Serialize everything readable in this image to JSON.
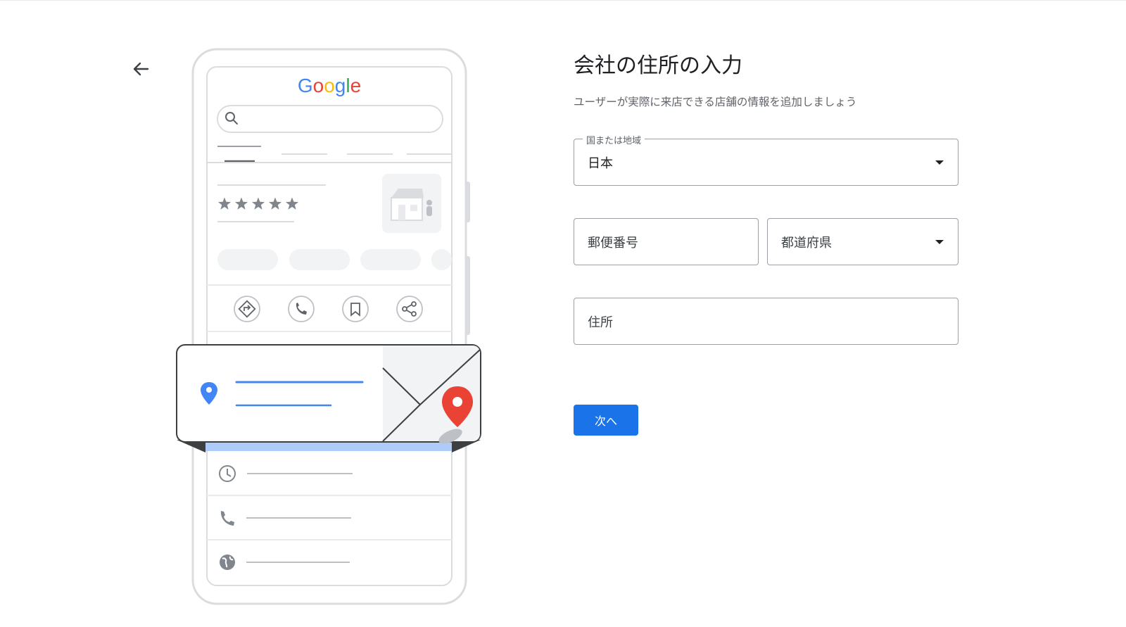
{
  "header": {
    "back_icon": "arrow-back-icon"
  },
  "illustration": {
    "google_logo": {
      "text": "Google",
      "letters": [
        "G",
        "o",
        "o",
        "g",
        "l",
        "e"
      ],
      "colors": [
        "#4285f4",
        "#ea4335",
        "#fbbc05",
        "#4285f4",
        "#34a853",
        "#ea4335"
      ]
    },
    "rating_stars": 5,
    "action_icons": [
      "directions-icon",
      "phone-icon",
      "bookmark-icon",
      "share-icon"
    ],
    "info_icons": [
      "clock-icon",
      "phone-icon",
      "globe-icon"
    ]
  },
  "form": {
    "title": "会社の住所の入力",
    "subtitle": "ユーザーが実際に来店できる店舗の情報を追加しましょう",
    "country": {
      "label": "国または地域",
      "value": "日本"
    },
    "postal_code": {
      "placeholder": "郵便番号"
    },
    "prefecture": {
      "placeholder": "都道府県"
    },
    "address": {
      "placeholder": "住所"
    },
    "next_label": "次へ"
  },
  "colors": {
    "accent": "#1a73e8",
    "map_pin": "#ea4335",
    "location_pin": "#4285f4"
  }
}
